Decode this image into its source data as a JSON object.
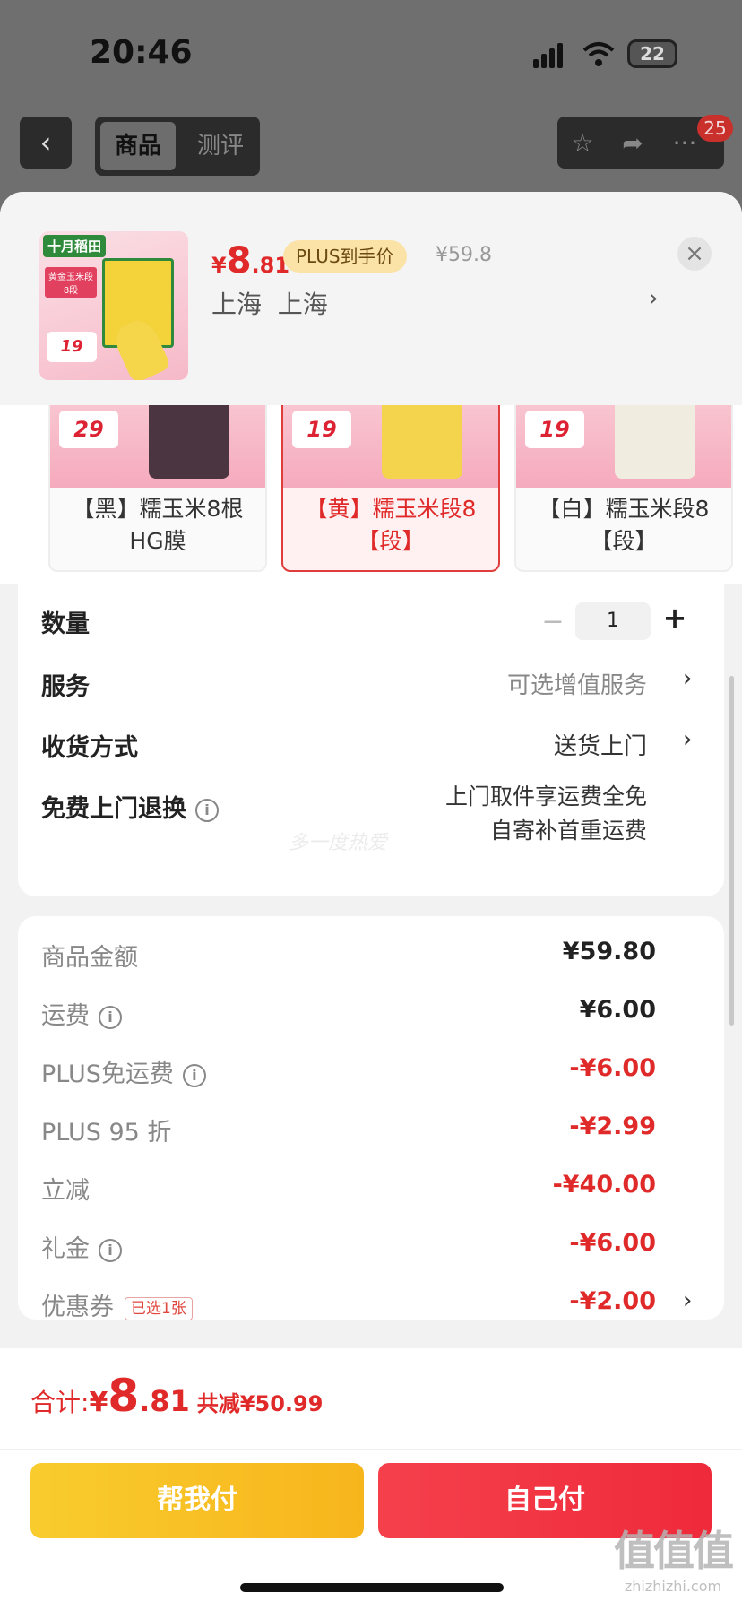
{
  "status_bar": {
    "time": "20:46",
    "battery": "22"
  },
  "background_nav": {
    "tabs": [
      "商品",
      "测评"
    ],
    "badge_count": "25"
  },
  "sheet_header": {
    "price": {
      "symbol": "¥",
      "integer": "8",
      "decimal": ".81"
    },
    "plus_tag": "PLUS到手价",
    "original_price": "¥59.8",
    "close": "×",
    "address": "上海  上海",
    "address_arrow": "›",
    "thumbnail": {
      "brand": "十月稻田",
      "promo": "黄金玉米段8段",
      "price": "19"
    }
  },
  "variants": [
    {
      "label": "【黑】糯玉米8根HG膜",
      "price_tag": "29",
      "selected": false
    },
    {
      "label": "【黄】糯玉米段8【段】",
      "price_tag": "19",
      "selected": true
    },
    {
      "label": "【白】糯玉米段8【段】",
      "price_tag": "19",
      "selected": false
    }
  ],
  "options": {
    "quantity_label": "数量",
    "quantity_value": "1",
    "minus": "−",
    "plus": "+",
    "service_label": "服务",
    "service_value": "可选增值服务",
    "delivery_label": "收货方式",
    "delivery_value": "送货上门",
    "return_label": "免费上门退换",
    "return_line1": "上门取件享运费全免",
    "return_line2": "自寄补首重运费",
    "watermark": "多一度热爱",
    "arrow": "›",
    "info": "i"
  },
  "summary": [
    {
      "label": "商品金额",
      "value": "¥59.80",
      "red": false,
      "info": false
    },
    {
      "label": "运费",
      "value": "¥6.00",
      "red": false,
      "info": true
    },
    {
      "label": "PLUS免运费",
      "value": "-¥6.00",
      "red": true,
      "info": true
    },
    {
      "label": "PLUS 95 折",
      "value": "-¥2.99",
      "red": true,
      "info": false
    },
    {
      "label": "立减",
      "value": "-¥40.00",
      "red": true,
      "info": false
    },
    {
      "label": "礼金",
      "value": "-¥6.00",
      "red": true,
      "info": true
    },
    {
      "label": "优惠券",
      "value": "-¥2.00",
      "red": true,
      "info": false,
      "chip": "已选1张"
    }
  ],
  "footer": {
    "total_label": "合计:",
    "total_symbol": "¥",
    "total_integer": "8",
    "total_decimal": ".81",
    "total_cut": "共减¥50.99",
    "help_pay": "帮我付",
    "self_pay": "自己付",
    "site_mark_big": "值值值",
    "site_mark_small": "zhizhizhi.com"
  },
  "colors": {
    "accent_red": "#e02a2a",
    "help_yellow": "#f9cc2d",
    "plus_gold": "#fbe3a8"
  }
}
